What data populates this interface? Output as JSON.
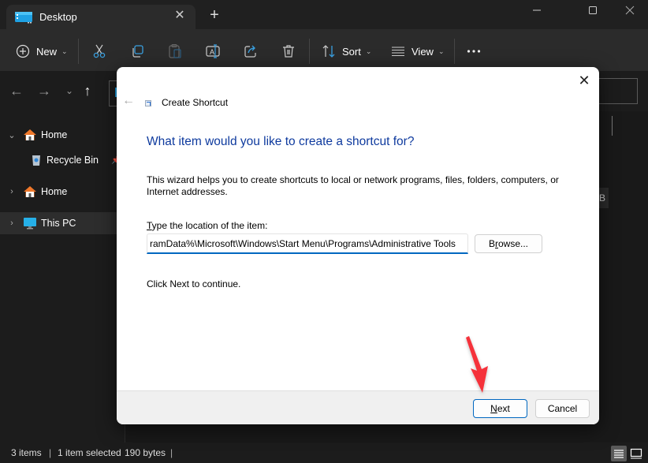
{
  "window": {
    "tab_title": "Desktop",
    "tab_icon": "desktop-folder-icon",
    "controls": [
      "minimize",
      "maximize",
      "close"
    ]
  },
  "toolbar": {
    "new_label": "New",
    "sort_label": "Sort",
    "view_label": "View",
    "icons": [
      "plus-circle-icon",
      "cut-icon",
      "copy-icon",
      "paste-icon",
      "rename-icon",
      "share-icon",
      "delete-icon",
      "sort-icon",
      "view-icon",
      "more-icon"
    ]
  },
  "nav": {
    "icons": [
      "back-icon",
      "forward-icon",
      "recent-icon",
      "up-icon"
    ]
  },
  "sidebar": {
    "items": [
      {
        "label": "Home",
        "expanded": true,
        "icon": "home-icon"
      },
      {
        "label": "Recycle Bin",
        "icon": "recycle-bin-icon",
        "pinned": true
      },
      {
        "label": "Home",
        "expanded": false,
        "icon": "home-icon"
      },
      {
        "label": "This PC",
        "expanded": false,
        "icon": "this-pc-icon",
        "selected": true
      }
    ]
  },
  "content": {
    "size_fragment": "B"
  },
  "status": {
    "items_count": "3 items",
    "separator": "|",
    "selection": "1 item selected",
    "size": "190 bytes"
  },
  "dialog": {
    "title": "Create Shortcut",
    "heading": "What item would you like to create a shortcut for?",
    "description": "This wizard helps you to create shortcuts to local or network programs, files, folders, computers, or Internet addresses.",
    "location_label_accel": "T",
    "location_label_rest": "ype the location of the item:",
    "location_value": "ramData%\\Microsoft\\Windows\\Start Menu\\Programs\\Administrative Tools",
    "browse_pre": "B",
    "browse_accel": "r",
    "browse_post": "owse...",
    "hint": "Click Next to continue.",
    "next_accel": "N",
    "next_rest": "ext",
    "cancel_label": "Cancel"
  },
  "annotation": {
    "arrow_color": "#f5333a"
  },
  "colors": {
    "heading": "#0e3a9e",
    "accent": "#0067c0",
    "explorer_bg": "#1c1c1c",
    "toolbar_bg": "#2b2b2b"
  }
}
